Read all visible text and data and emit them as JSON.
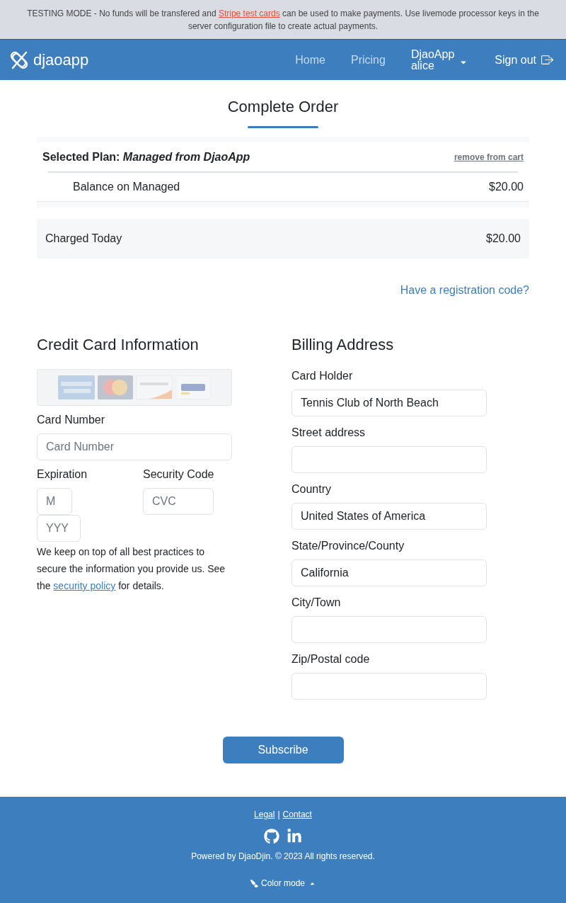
{
  "notice": {
    "before": "TESTING MODE - No funds will be transfered and",
    "link": "Stripe test cards",
    "after": "can be used to make payments. Use livemode processor keys in the server configuration file to create actual payments."
  },
  "navbar": {
    "brand": "djaoapp",
    "links": [
      {
        "label": "Home"
      },
      {
        "label": "Pricing"
      }
    ],
    "account": {
      "organization": "DjaoApp",
      "user": "alice"
    },
    "sign_out": "Sign out"
  },
  "title": "Complete Order",
  "cart": {
    "plan_title": "Selected Plan: *Managed from DjaoApp*",
    "remove": "remove from cart",
    "lines": [
      {
        "description": "Balance on Managed",
        "amount": "$20.00"
      }
    ],
    "total": {
      "label": "Charged Today",
      "amount": "$20.00"
    }
  },
  "registration_link": "Have a registration code?",
  "credit_card": {
    "heading": "Credit Card Information",
    "card_number": {
      "label": "Card Number",
      "placeholder": "Card Number"
    },
    "expiration": {
      "label": "Expiration",
      "month_placeholder": "M",
      "year_placeholder": "YYY"
    },
    "security_code": {
      "label": "Security Code",
      "placeholder": "CVC"
    },
    "note": {
      "before": "We keep on top of all best practices to secure the information you provide us. See the",
      "link": "security policy",
      "after": "for details."
    }
  },
  "billing": {
    "heading": "Billing Address",
    "fields": [
      {
        "label": "Card Holder",
        "value": "Tennis Club of North Beach"
      },
      {
        "label": "Street address"
      },
      {
        "label": "Country",
        "value": "United States of America"
      },
      {
        "label": "State/Province/County",
        "value": "California"
      },
      {
        "label": "City/Town"
      },
      {
        "label": "Zip/Postal code"
      }
    ]
  },
  "subscribe": "Subscribe",
  "footer": {
    "links": [
      {
        "label": "Legal"
      },
      {
        "label": "Contact"
      }
    ],
    "separator": "|",
    "copyright": "Powered by DjaoDjin. © 2023 All rights reserved.",
    "color_mode": "Color mode"
  }
}
